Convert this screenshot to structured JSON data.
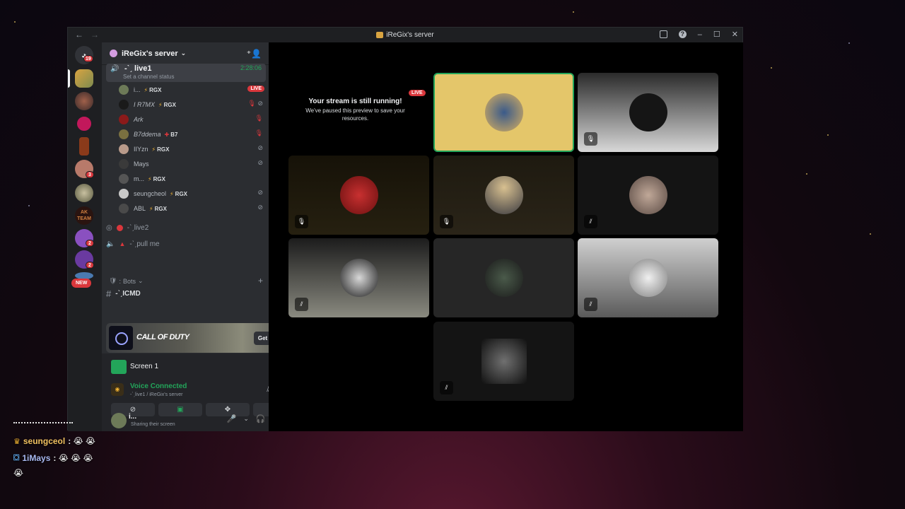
{
  "window": {
    "title": "iReGix's server"
  },
  "rail": {
    "dm_badge": "19",
    "badge_a": "3",
    "badge_b": "2",
    "badge_c": "2",
    "new_label": "NEW",
    "team_label": "AK TEAM"
  },
  "server": {
    "name": "iReGix's server"
  },
  "active_channel": {
    "name": "·̩̩̥͙**̩̩̥͙˚ ̩̥̩̥*̩̩͙✩ live1",
    "display_name": "-ˋˏ live1",
    "timer": "2:28:06",
    "status": "Set a channel status"
  },
  "users": [
    {
      "name": "i...",
      "tag": "RGX",
      "live": "LIVE"
    },
    {
      "name": "I R7MX",
      "tag": "RGX"
    },
    {
      "name": "Ark",
      "tag": ""
    },
    {
      "name": "B7ddema",
      "tag": "B7"
    },
    {
      "name": "IIYzn",
      "tag": "RGX"
    },
    {
      "name": "Mays",
      "tag": ""
    },
    {
      "name": "m...",
      "tag": "RGX"
    },
    {
      "name": "seungcheol",
      "tag": "RGX"
    },
    {
      "name": "ABL",
      "tag": "RGX"
    }
  ],
  "voice_channels": [
    {
      "name": "-ˋˏlive2"
    },
    {
      "name": "-ˋˏpull me"
    }
  ],
  "category": {
    "name": "Bots"
  },
  "text_channel": {
    "name": "-ˋˏICMD"
  },
  "promo": {
    "game": "CALL OF DUTY",
    "button": "Get Reward!"
  },
  "screen_share": {
    "label": "Screen 1"
  },
  "voice": {
    "status": "Voice Connected",
    "location": "-ˋˏlive1 / iReGix's server"
  },
  "user_panel": {
    "name": "i...",
    "status": "Sharing their screen"
  },
  "stage": {
    "paused_title": "Your stream is still running!",
    "paused_body": "We've paused this preview to save your resources.",
    "live_badge": "LIVE"
  },
  "chat": [
    {
      "name": "seungceol",
      "text": ": 😭 😭"
    },
    {
      "name": "1iMays",
      "text": ": 😭 😭 😭"
    },
    {
      "name": "",
      "text": "😭"
    }
  ],
  "colors": {
    "accent": "#23a55a",
    "danger": "#da373c",
    "sidebar": "#2b2d31",
    "rail": "#1e1f22"
  }
}
